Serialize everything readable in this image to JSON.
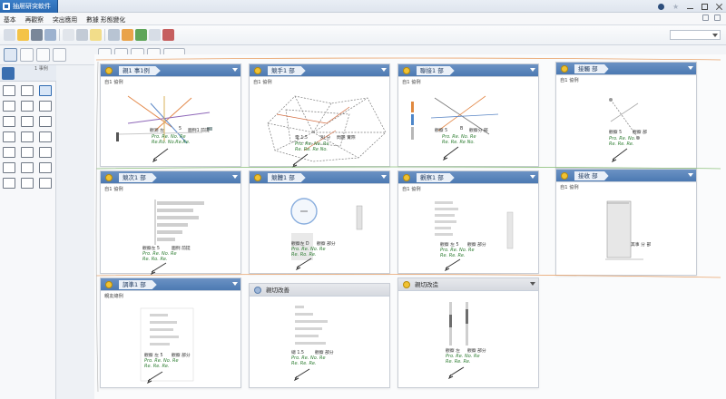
{
  "app": {
    "tab_title": "抽屜研突軟件"
  },
  "menubar": {
    "items": [
      "基本",
      "再觀察",
      "突出應用",
      "數據 形態變化"
    ]
  },
  "palette": {
    "title": "1 事例"
  },
  "cards": [
    {
      "title": "親1 事1例",
      "subtitle": "自1 協例",
      "labels": [
        "觀測 左",
        "5",
        "圖例1 前提"
      ],
      "notes": [
        "Pro. Re. No. Re",
        "Re.Ro. No.Re.Re."
      ]
    },
    {
      "title": "競手1 部",
      "subtitle": "自1 協例",
      "labels": [
        "電 1.5",
        "別 分",
        "問題 實際"
      ],
      "notes": [
        "Pro. Re. No. Re",
        "Re. Re. Re No."
      ]
    },
    {
      "title": "聯接1 部",
      "subtitle": "自1 協例",
      "labels": [
        "觀察 5",
        "B",
        "觀察分 部"
      ],
      "notes": [
        "Pro. Re. No. Re",
        "Re. Re. Re No."
      ]
    },
    {
      "title": "接觸 部",
      "subtitle": "自1 協例",
      "labels": [
        "觀察 5",
        "觀察 部"
      ],
      "notes": [
        "Pro. Re. No.",
        "Re. Re. Re."
      ]
    },
    {
      "title": "競次1 部",
      "subtitle": "自1 協例",
      "labels": [
        "觀察左 5",
        "圖例 前提"
      ],
      "notes": [
        "Pro. Re. No. Re",
        "Re. Ro. Re."
      ]
    },
    {
      "title": "競體1 部",
      "subtitle": "",
      "labels": [
        "觀察左 D",
        "觀察 部分"
      ],
      "notes": [
        "Pro. Re. No. Re",
        "Re. Ro. Re."
      ]
    },
    {
      "title": "觀察1 部",
      "subtitle": "自1 協例",
      "labels": [
        "觀察 左 5",
        "觀察 部分"
      ],
      "notes": [
        "Pro. Re. No. Re",
        "Re. Re. Re."
      ]
    },
    {
      "title": "接收 部",
      "subtitle": "自1 協例",
      "labels": [
        "其事 分 部"
      ],
      "notes": []
    },
    {
      "title": "調準1 部",
      "subtitle": "親友總例",
      "labels": [
        "觀察 左 5",
        "觀察 部分"
      ],
      "notes": [
        "Pro. Re. No. Re",
        "Re. Re. Re."
      ]
    },
    {
      "title": "親切改善",
      "subtitle": "",
      "labels": [
        "總 1.5",
        "觀察 部分"
      ],
      "notes": [
        "Pro. Re. No. Re",
        "Re. Re. Re."
      ]
    },
    {
      "title": "親切改造",
      "subtitle": "",
      "labels": [
        "觀察 左",
        "觀察 部分"
      ],
      "notes": [
        "Pro. Re. No. Re",
        "Re. Re. Re."
      ]
    }
  ]
}
